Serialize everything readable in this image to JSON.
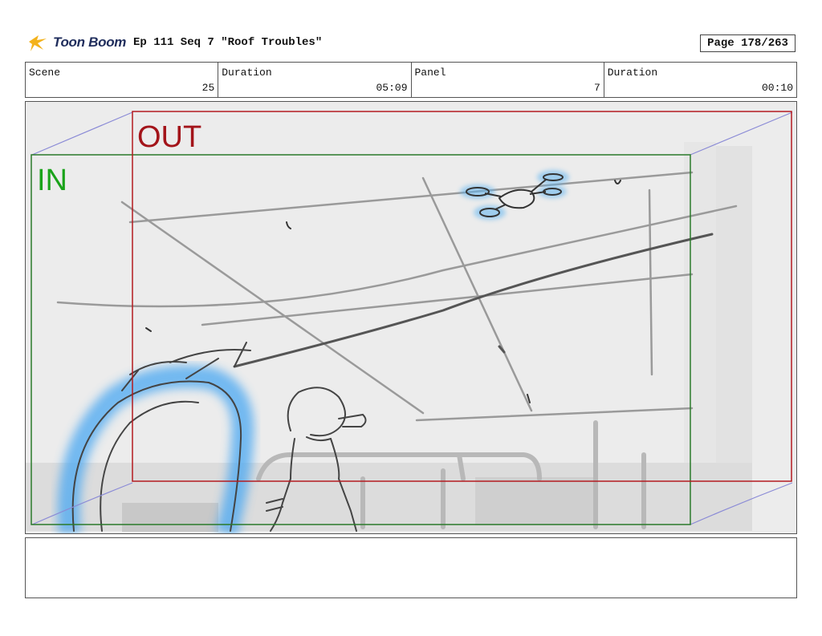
{
  "header": {
    "logo_text": "Toon Boom",
    "episode_title": "Ep 111 Seq 7 \"Roof Troubles\"",
    "page_label": "Page 178/263"
  },
  "info": {
    "scene_label": "Scene",
    "scene_value": "25",
    "scene_duration_label": "Duration",
    "scene_duration_value": "05:09",
    "panel_label": "Panel",
    "panel_value": "7",
    "panel_duration_label": "Duration",
    "panel_duration_value": "00:10"
  },
  "panel": {
    "out_label": "OUT",
    "in_label": "IN"
  },
  "notes": {
    "text": ""
  },
  "colors": {
    "out_frame": "#b31b20",
    "in_frame": "#2a7a2a",
    "camera_path": "#8a8ad6",
    "glow": "#5fb4f0"
  },
  "icons": [
    "toon-boom-logo-icon"
  ]
}
